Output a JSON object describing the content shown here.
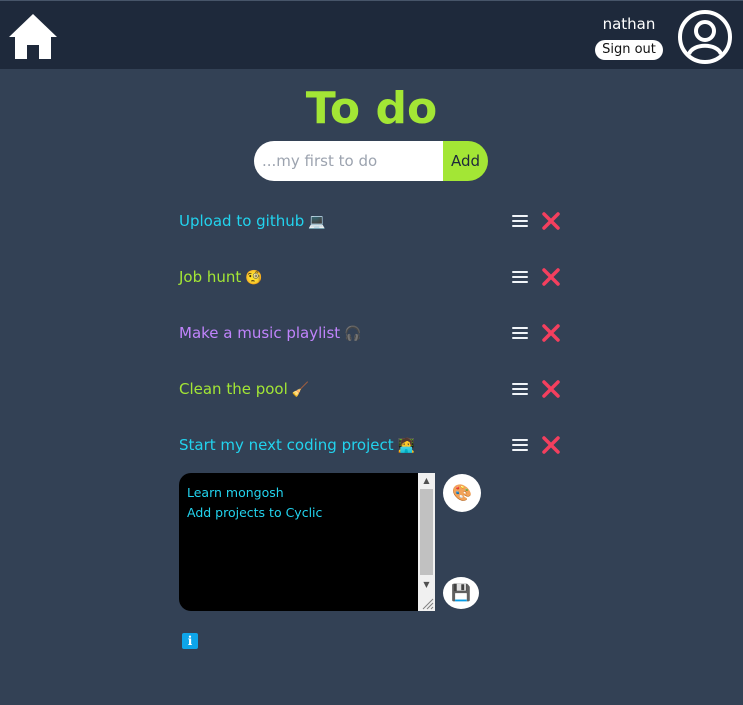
{
  "header": {
    "username": "nathan",
    "signout_label": "Sign out",
    "home_icon": "home-icon",
    "avatar_icon": "user-circle-icon"
  },
  "main": {
    "title": "To do",
    "add_placeholder": "...my first to do",
    "add_label": "Add"
  },
  "todos": [
    {
      "text": "Upload to github",
      "emoji": "💻",
      "color": "#22d3ee"
    },
    {
      "text": "Job hunt",
      "emoji": "🧐",
      "color": "#a3e635"
    },
    {
      "text": "Make a music playlist",
      "emoji": "🎧",
      "color": "#c084fc"
    },
    {
      "text": "Clean the pool",
      "emoji": "🧹",
      "color": "#a3e635"
    },
    {
      "text": "Start my next coding project",
      "emoji": "🧑‍💻",
      "color": "#22d3ee"
    }
  ],
  "notes": {
    "value": "Learn mongosh\nAdd projects to Cyclic"
  },
  "note_actions": {
    "palette_emoji": "🎨",
    "save_emoji": "💾",
    "info_label": "i"
  },
  "colors": {
    "background": "#334155",
    "header": "#1e293b",
    "accent": "#a3e635",
    "delete": "#f43f5e",
    "info": "#0ea5e9"
  }
}
